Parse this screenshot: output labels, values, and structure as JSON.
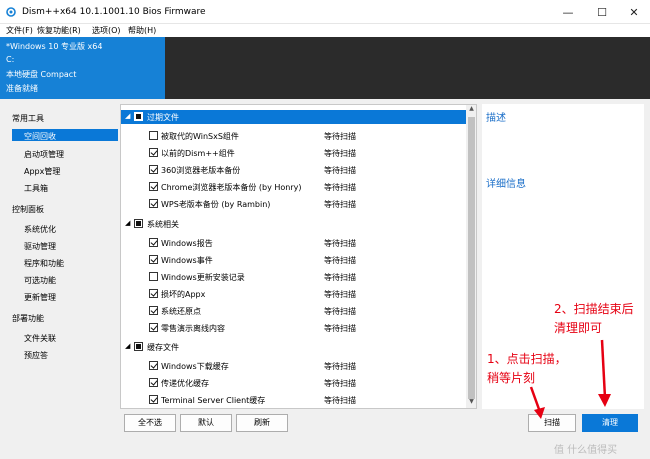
{
  "window": {
    "title": "Dism++x64 10.1.1001.10 Bios Firmware",
    "minimize": "—",
    "maximize": "☐",
    "close": "✕"
  },
  "menu": [
    "文件(F)",
    "恢复功能(R)",
    "选项(O)",
    "帮助(H)"
  ],
  "info": [
    "*Windows 10 专业版 x64",
    "C:",
    "本地硬盘 Compact",
    "准备就绪"
  ],
  "nav": [
    {
      "label": "常用工具",
      "type": "header"
    },
    {
      "label": "空间回收",
      "type": "item",
      "selected": true
    },
    {
      "label": "启动项管理",
      "type": "item"
    },
    {
      "label": "Appx管理",
      "type": "item"
    },
    {
      "label": "工具箱",
      "type": "item"
    },
    {
      "label": "控制面板",
      "type": "header"
    },
    {
      "label": "系统优化",
      "type": "item"
    },
    {
      "label": "驱动管理",
      "type": "item"
    },
    {
      "label": "程序和功能",
      "type": "item"
    },
    {
      "label": "可选功能",
      "type": "item"
    },
    {
      "label": "更新管理",
      "type": "item"
    },
    {
      "label": "部署功能",
      "type": "header"
    },
    {
      "label": "文件关联",
      "type": "item"
    },
    {
      "label": "预应答",
      "type": "item"
    }
  ],
  "groups": [
    {
      "label": "过期文件",
      "selected": true,
      "items": [
        {
          "label": "被取代的WinSxS组件",
          "checked": false,
          "status": "等待扫描"
        },
        {
          "label": "以前的Dism++组件",
          "checked": true,
          "status": "等待扫描"
        },
        {
          "label": "360浏览器老版本备份",
          "checked": true,
          "status": "等待扫描"
        },
        {
          "label": "Chrome浏览器老版本备份 (by Honry)",
          "checked": true,
          "status": "等待扫描"
        },
        {
          "label": "WPS老版本备份 (by Rambin)",
          "checked": true,
          "status": "等待扫描"
        }
      ]
    },
    {
      "label": "系统相关",
      "selected": false,
      "items": [
        {
          "label": "Windows报告",
          "checked": true,
          "status": "等待扫描"
        },
        {
          "label": "Windows事件",
          "checked": true,
          "status": "等待扫描"
        },
        {
          "label": "Windows更新安装记录",
          "checked": false,
          "status": "等待扫描"
        },
        {
          "label": "损坏的Appx",
          "checked": true,
          "status": "等待扫描"
        },
        {
          "label": "系统还原点",
          "checked": true,
          "status": "等待扫描"
        },
        {
          "label": "零售演示离线内容",
          "checked": true,
          "status": "等待扫描"
        }
      ]
    },
    {
      "label": "缓存文件",
      "selected": false,
      "items": [
        {
          "label": "Windows下载缓存",
          "checked": true,
          "status": "等待扫描"
        },
        {
          "label": "传递优化缓存",
          "checked": true,
          "status": "等待扫描"
        },
        {
          "label": "Terminal Server Client缓存",
          "checked": true,
          "status": "等待扫描"
        }
      ]
    }
  ],
  "right": {
    "describe": "描述",
    "details": "详细信息"
  },
  "buttons": {
    "select_none": "全不选",
    "default": "默认",
    "refresh": "刷新",
    "scan": "扫描",
    "clean": "清理"
  },
  "annotations": {
    "step1_line1": "1、点击扫描，",
    "step1_line2": "稍等片刻",
    "step2_line1": "2、扫描结束后",
    "step2_line2": "清理即可"
  },
  "watermark": "值 什么值得买",
  "colors": {
    "accent": "#0a78d7",
    "annotation": "#e60012"
  }
}
